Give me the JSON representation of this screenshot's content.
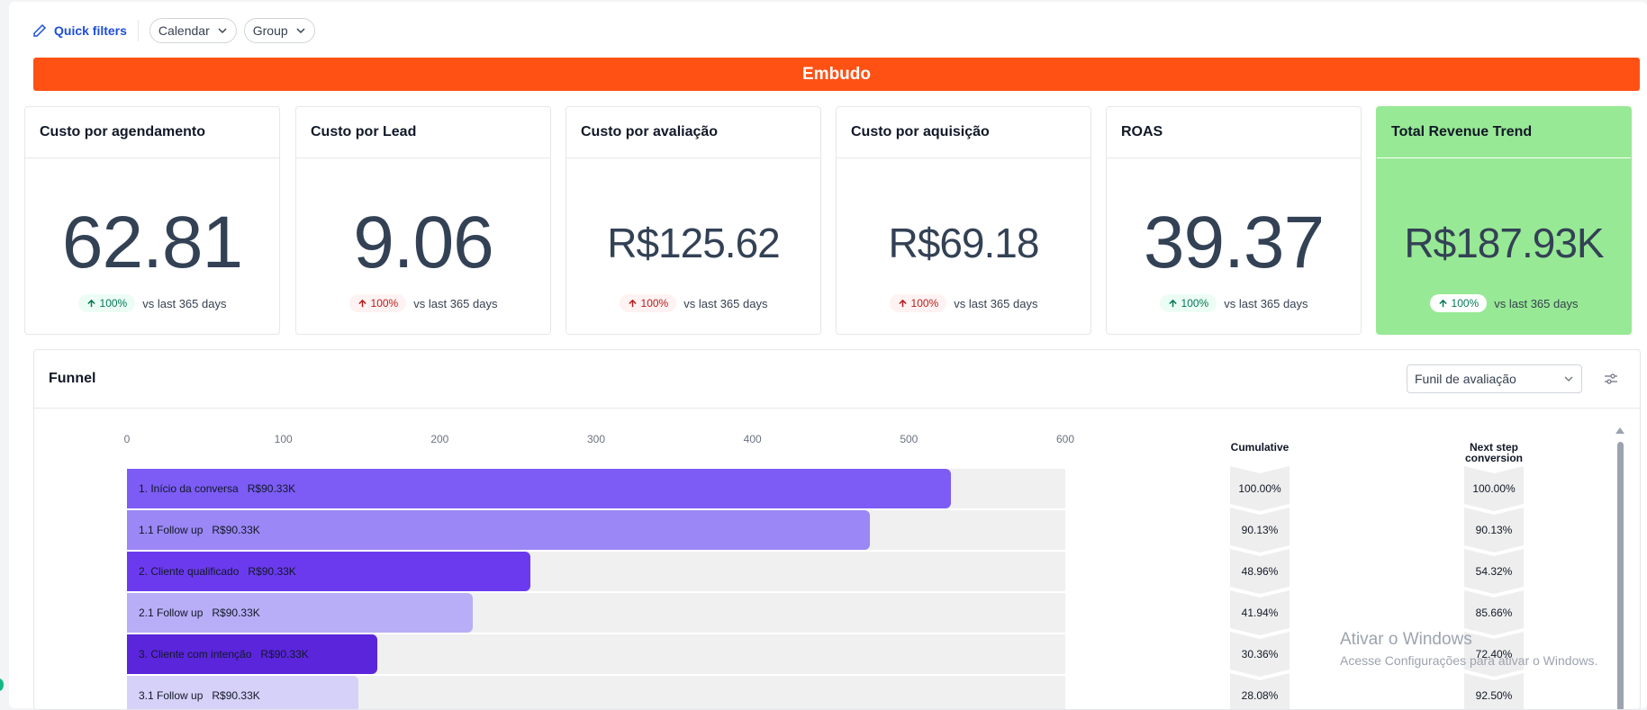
{
  "filters": {
    "quick_filters_label": "Quick filters",
    "calendar_label": "Calendar",
    "group_label": "Group"
  },
  "banner": {
    "title": "Embudo"
  },
  "cards": [
    {
      "title": "Custo por agendamento",
      "value": "62.81",
      "delta": "100%",
      "comparison": "vs last 365 days",
      "trend": "up-good"
    },
    {
      "title": "Custo por Lead",
      "value": "9.06",
      "delta": "100%",
      "comparison": "vs last 365 days",
      "trend": "up-bad"
    },
    {
      "title": "Custo por avaliação",
      "value": "R$125.62",
      "delta": "100%",
      "comparison": "vs last 365 days",
      "trend": "up-bad"
    },
    {
      "title": "Custo por aquisição",
      "value": "R$69.18",
      "delta": "100%",
      "comparison": "vs last 365 days",
      "trend": "up-bad"
    },
    {
      "title": "ROAS",
      "value": "39.37",
      "delta": "100%",
      "comparison": "vs last 365 days",
      "trend": "up-good"
    },
    {
      "title": "Total Revenue Trend",
      "value": "R$187.93K",
      "delta": "100%",
      "comparison": "vs last 365 days",
      "trend": "up-good"
    }
  ],
  "funnel": {
    "title": "Funnel",
    "select_value": "Funil de avaliação",
    "cumulative_header": "Cumulative",
    "next_step_header_line1": "Next step",
    "next_step_header_line2": "conversion"
  },
  "chart_data": {
    "type": "bar",
    "orientation": "horizontal",
    "xlim": [
      0,
      600
    ],
    "x_ticks": [
      "0",
      "100",
      "200",
      "300",
      "400",
      "500",
      "600"
    ],
    "stages": [
      {
        "label": "1. Início da conversa",
        "amount": "R$90.33K",
        "value": 527,
        "color": "#7c5cf5",
        "cumulative": "100.00%",
        "next_step": "100.00%"
      },
      {
        "label": "1.1 Follow up",
        "amount": "R$90.33K",
        "value": 475,
        "color": "#9b87f5",
        "cumulative": "90.13%",
        "next_step": "90.13%"
      },
      {
        "label": "2. Cliente qualificado",
        "amount": "R$90.33K",
        "value": 258,
        "color": "#6b3aef",
        "cumulative": "48.96%",
        "next_step": "54.32%"
      },
      {
        "label": "2.1 Follow up",
        "amount": "R$90.33K",
        "value": 221,
        "color": "#b8aef8",
        "cumulative": "41.94%",
        "next_step": "85.66%"
      },
      {
        "label": "3. Cliente com intenção",
        "amount": "R$90.33K",
        "value": 160,
        "color": "#5b25dc",
        "cumulative": "30.36%",
        "next_step": "72.40%"
      },
      {
        "label": "3.1 Follow up",
        "amount": "R$90.33K",
        "value": 148,
        "color": "#d6d1f8",
        "cumulative": "28.08%",
        "next_step": "92.50%"
      }
    ]
  },
  "watermark": {
    "line1": "Ativar o Windows",
    "line2": "Acesse Configurações para ativar o Windows."
  }
}
